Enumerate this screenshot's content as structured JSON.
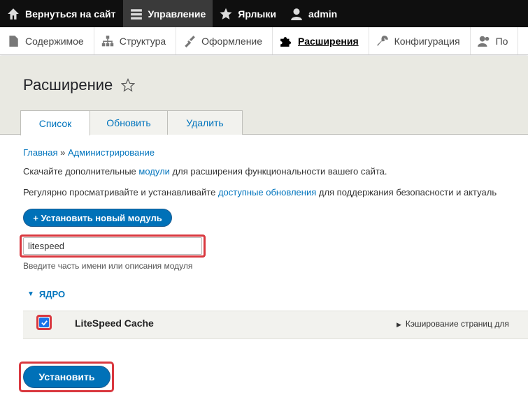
{
  "toolbar": {
    "back": "Вернуться на сайт",
    "manage": "Управление",
    "shortcuts": "Ярлыки",
    "user": "admin"
  },
  "tray": {
    "items": [
      "Содержимое",
      "Структура",
      "Оформление",
      "Расширения",
      "Конфигурация",
      "По"
    ]
  },
  "page": {
    "title": "Расширение"
  },
  "tabs": [
    "Список",
    "Обновить",
    "Удалить"
  ],
  "breadcrumb": {
    "home": "Главная",
    "sep": "»",
    "admin": "Администрирование"
  },
  "intro": {
    "p1_pre": "Скачайте дополнительные ",
    "p1_link": "модули",
    "p1_post": " для расширения функциональности вашего сайта.",
    "p2_pre": "Регулярно просматривайте и устанавливайте ",
    "p2_link": "доступные обновления",
    "p2_post": " для поддержания безопасности и актуаль"
  },
  "add_module_button": "+ Установить новый модуль",
  "filter": {
    "value": "litespeed",
    "hint": "Введите часть имени или описания модуля"
  },
  "section": {
    "label": "ЯДРО"
  },
  "module": {
    "name": "LiteSpeed Cache",
    "description": "Кэширование страниц для",
    "checked": true
  },
  "install_button": "Установить"
}
